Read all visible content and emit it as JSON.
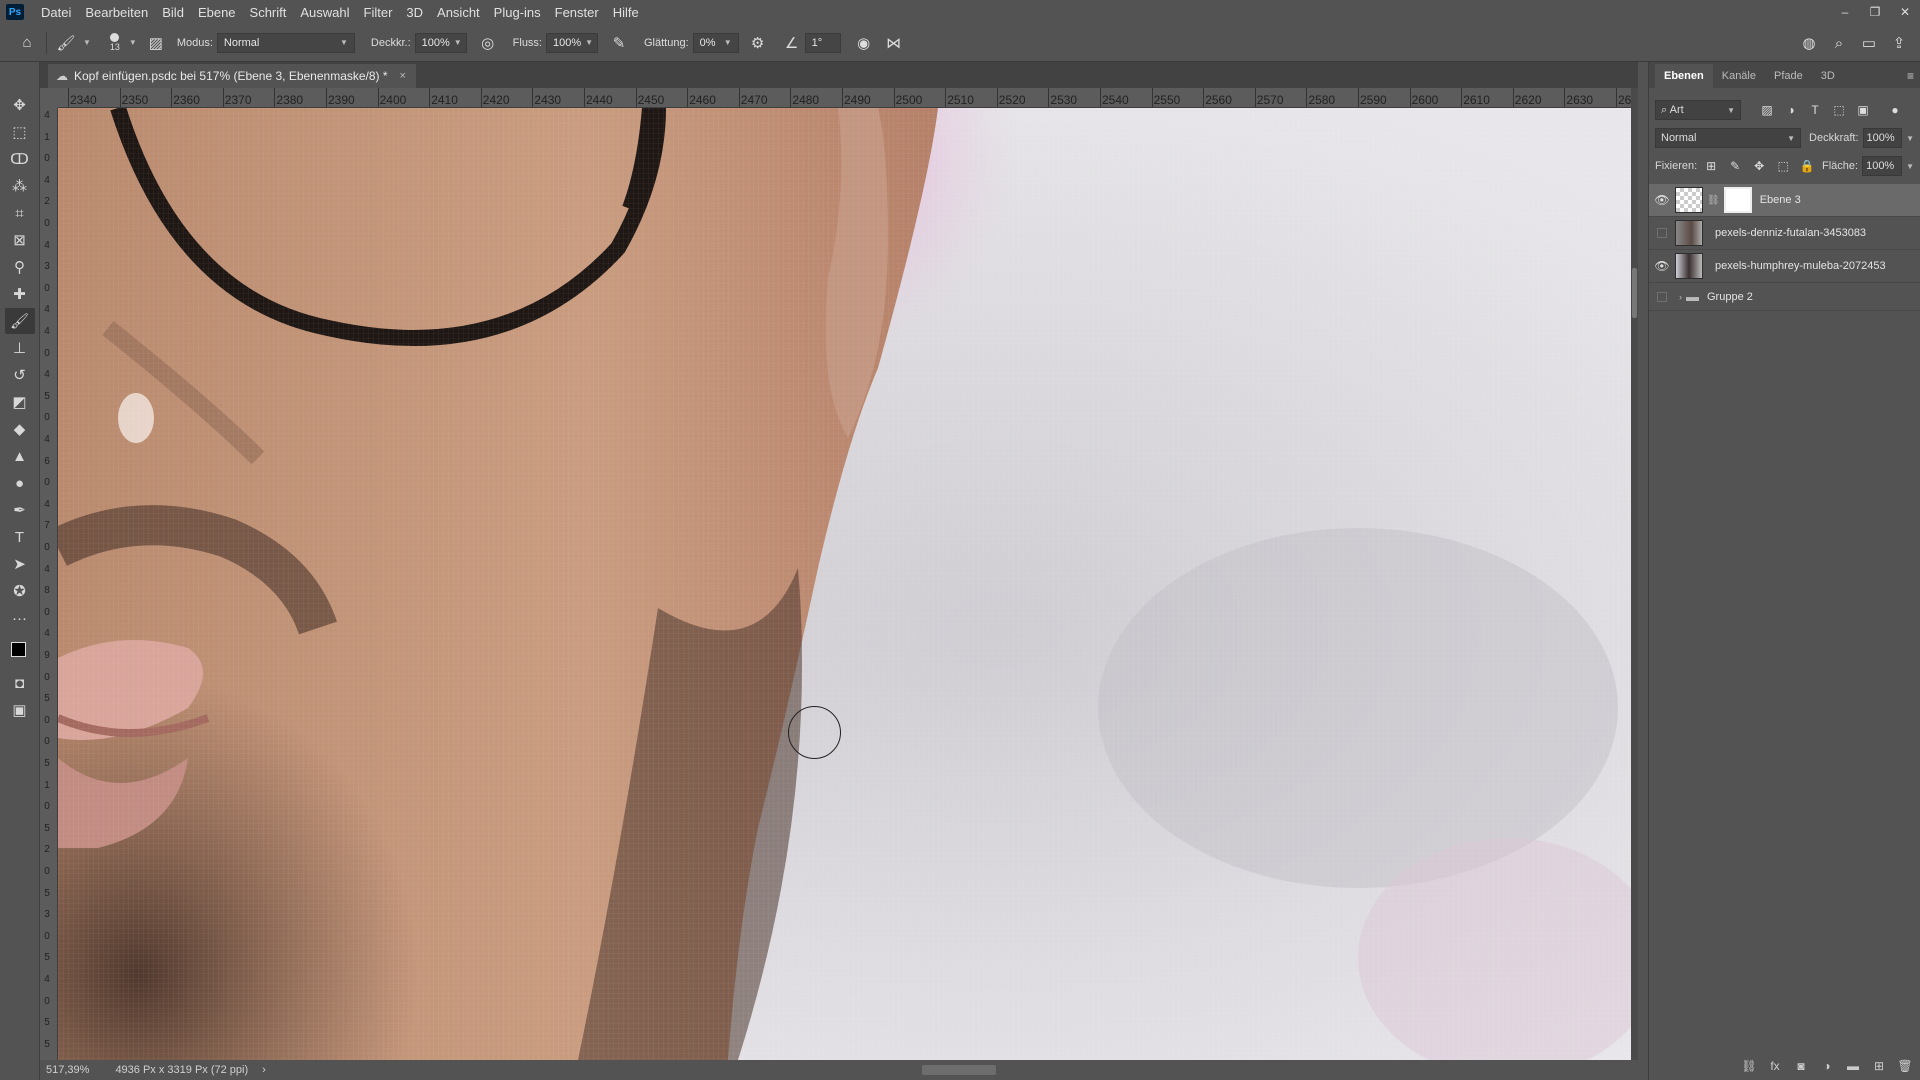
{
  "app": {
    "logo": "Ps"
  },
  "menu": [
    "Datei",
    "Bearbeiten",
    "Bild",
    "Ebene",
    "Schrift",
    "Auswahl",
    "Filter",
    "3D",
    "Ansicht",
    "Plug-ins",
    "Fenster",
    "Hilfe"
  ],
  "window_controls": {
    "minimize": "–",
    "restore": "❐",
    "close": "✕"
  },
  "options": {
    "brush_size": "13",
    "mode_label": "Modus:",
    "mode_value": "Normal",
    "opacity_label": "Deckkr.:",
    "opacity_value": "100%",
    "flow_label": "Fluss:",
    "flow_value": "100%",
    "smoothing_label": "Glättung:",
    "smoothing_value": "0%",
    "angle_value": "1°"
  },
  "document": {
    "tab_title": "Kopf einfügen.psdc bei 517% (Ebene 3, Ebenenmaske/8) *",
    "close": "×"
  },
  "ruler": {
    "h_ticks": [
      "2340",
      "2350",
      "2360",
      "2370",
      "2380",
      "2390",
      "2400",
      "2410",
      "2420",
      "2430",
      "2440",
      "2450",
      "2460",
      "2470",
      "2480",
      "2490",
      "2500",
      "2510",
      "2520",
      "2530",
      "2540",
      "2550",
      "2560",
      "2570",
      "2580",
      "2590",
      "2600",
      "2610",
      "2620",
      "2630",
      "26"
    ],
    "v_ticks": [
      "4",
      "1",
      "0",
      "4",
      "2",
      "0",
      "4",
      "3",
      "0",
      "4",
      "4",
      "0",
      "4",
      "5",
      "0",
      "4",
      "6",
      "0",
      "4",
      "7",
      "0",
      "4",
      "8",
      "0",
      "4",
      "9",
      "0",
      "5",
      "0",
      "0",
      "5",
      "1",
      "0",
      "5",
      "2",
      "0",
      "5",
      "3",
      "0",
      "5",
      "4",
      "0",
      "5",
      "5",
      "0"
    ]
  },
  "status": {
    "zoom": "517,39%",
    "doc_info": "4936 Px x 3319 Px (72 ppi)",
    "arrow": "›"
  },
  "layers_panel": {
    "tabs": [
      "Ebenen",
      "Kanäle",
      "Pfade",
      "3D"
    ],
    "filter_label": "Art",
    "blend_mode": "Normal",
    "opacity_label": "Deckkraft:",
    "opacity_value": "100%",
    "lock_label": "Fixieren:",
    "fill_label": "Fläche:",
    "fill_value": "100%",
    "layers": [
      {
        "name": "Ebene 3",
        "visible": true,
        "selected": true,
        "mask": true
      },
      {
        "name": "pexels-denniz-futalan-3453083",
        "visible": false,
        "selected": false
      },
      {
        "name": "pexels-humphrey-muleba-2072453",
        "visible": true,
        "selected": false
      },
      {
        "name": "Gruppe 2",
        "visible": false,
        "selected": false,
        "group": true
      }
    ]
  }
}
